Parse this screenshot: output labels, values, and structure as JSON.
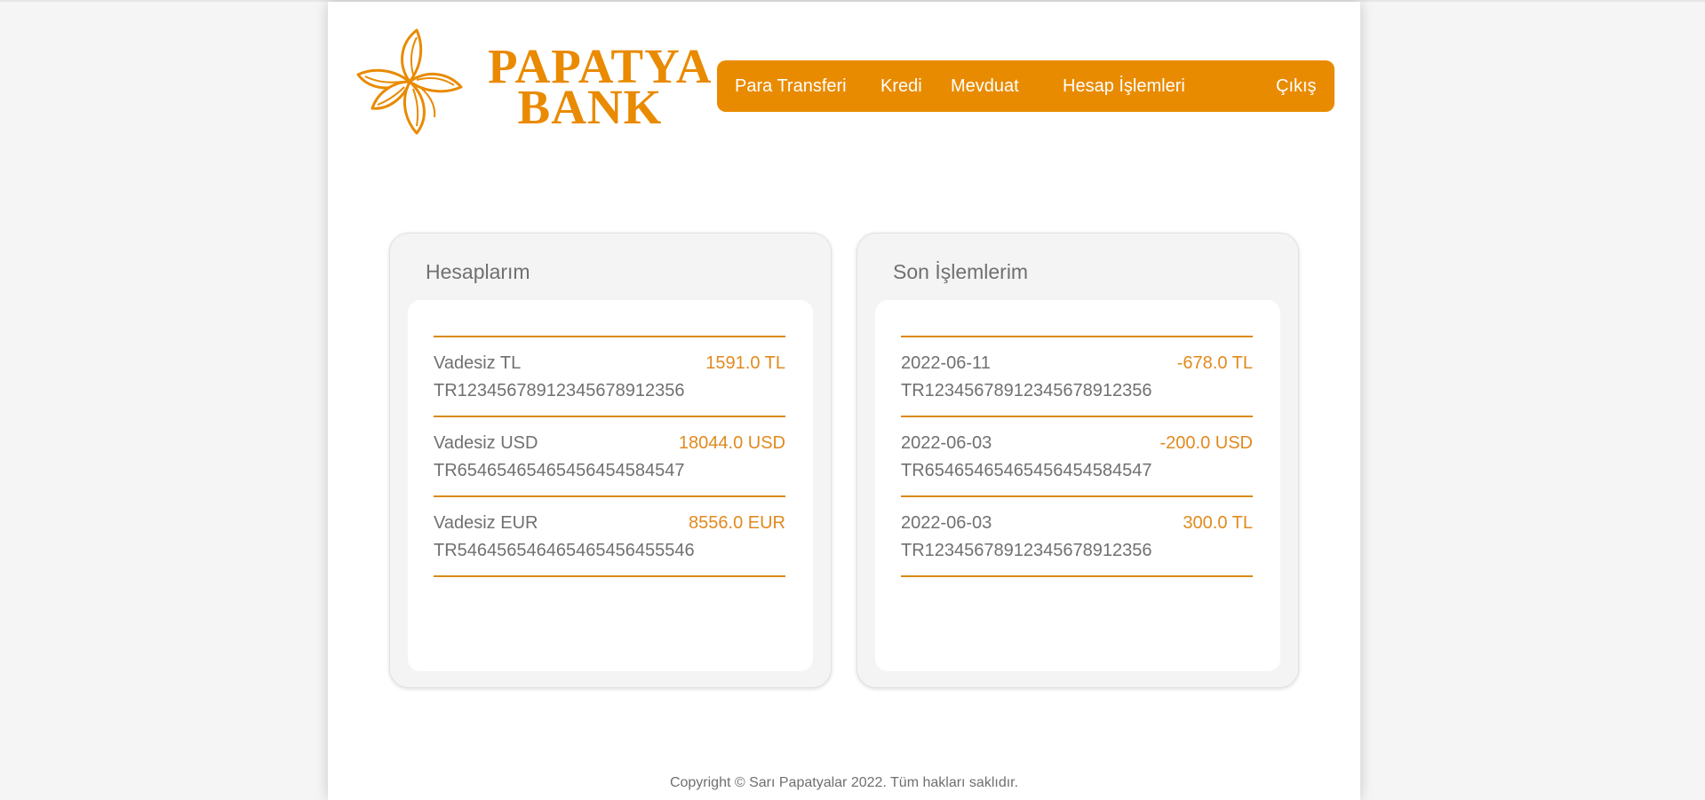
{
  "brand": {
    "line1": "PAPATYA",
    "line2": "BANK",
    "color": "#e98a00",
    "logo_icon": "daisy-flower-icon"
  },
  "nav": {
    "items": [
      "Para Transferi",
      "Kredi",
      "Mevduat",
      "Hesap İşlemleri"
    ],
    "logout": "Çıkış",
    "color": "#e98b00"
  },
  "accounts": {
    "title": "Hesaplarım",
    "items": [
      {
        "name": "Vadesiz TL",
        "amount": "1591.0 TL",
        "iban": "TR12345678912345678912356"
      },
      {
        "name": "Vadesiz USD",
        "amount": "18044.0 USD",
        "iban": "TR65465465465456454584547"
      },
      {
        "name": "Vadesiz EUR",
        "amount": "8556.0 EUR",
        "iban": "TR546456546465465456455546"
      }
    ]
  },
  "transactions": {
    "title": "Son İşlemlerim",
    "items": [
      {
        "date": "2022-06-11",
        "amount": "-678.0 TL",
        "iban": "TR12345678912345678912356"
      },
      {
        "date": "2022-06-03",
        "amount": "-200.0 USD",
        "iban": "TR65465465465456454584547"
      },
      {
        "date": "2022-06-03",
        "amount": "300.0 TL",
        "iban": "TR12345678912345678912356"
      }
    ]
  },
  "footer": {
    "text": "Copyright © Sarı Papatyalar 2022. Tüm hakları saklıdır."
  }
}
